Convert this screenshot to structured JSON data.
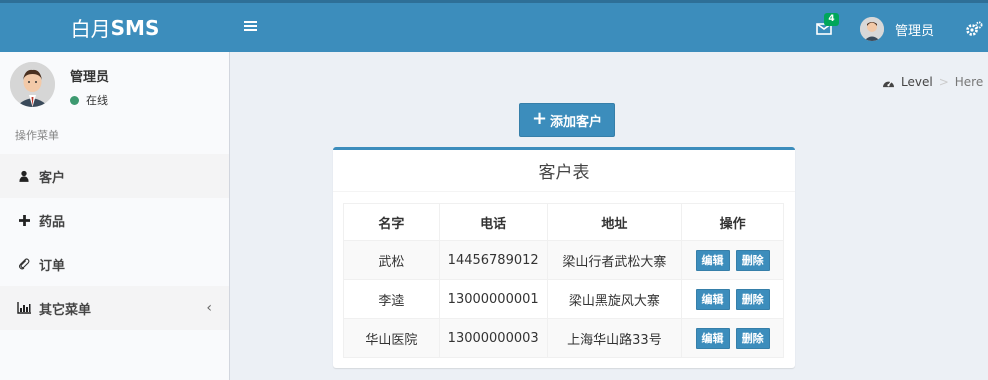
{
  "header": {
    "logo_light": "白月",
    "logo_bold": "SMS",
    "mail_badge": "4",
    "user_name": "管理员"
  },
  "sidebar": {
    "user_name": "管理员",
    "status": "在线",
    "menu_header": "操作菜单",
    "items": [
      {
        "label": "客户",
        "icon": "user-icon"
      },
      {
        "label": "药品",
        "icon": "plus-icon"
      },
      {
        "label": "订单",
        "icon": "paperclip-icon"
      },
      {
        "label": "其它菜单",
        "icon": "bar-chart-icon"
      }
    ]
  },
  "breadcrumb": {
    "level": "Level",
    "separator": ">",
    "here": "Here"
  },
  "main": {
    "add_button": "添加客户",
    "table_title": "客户表",
    "columns": [
      "名字",
      "电话",
      "地址",
      "操作"
    ],
    "rows": [
      {
        "name": "武松",
        "phone": "14456789012",
        "address": "梁山行者武松大寨",
        "edit": "编辑",
        "delete": "删除"
      },
      {
        "name": "李逵",
        "phone": "13000000001",
        "address": "梁山黑旋风大寨",
        "edit": "编辑",
        "delete": "删除"
      },
      {
        "name": "华山医院",
        "phone": "13000000003",
        "address": "上海华山路33号",
        "edit": "编辑",
        "delete": "删除"
      }
    ]
  },
  "colors": {
    "primary": "#3c8dbc",
    "online": "#3d9970",
    "badge": "#00a65a"
  }
}
